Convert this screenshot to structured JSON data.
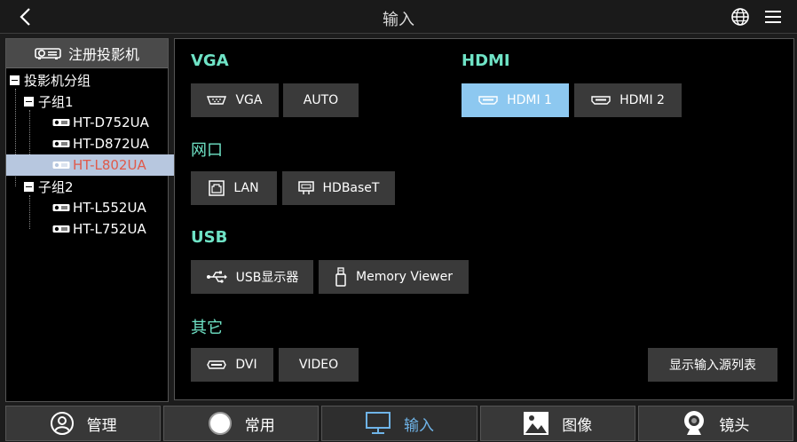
{
  "header": {
    "title": "输入"
  },
  "sidebar": {
    "register_label": "注册投影机",
    "root": "投影机分组",
    "groups": [
      {
        "label": "子组1",
        "devices": [
          "HT-D752UA",
          "HT-D872UA",
          "HT-L802UA"
        ]
      },
      {
        "label": "子组2",
        "devices": [
          "HT-L552UA",
          "HT-L752UA"
        ]
      }
    ],
    "selected_device": "HT-L802UA"
  },
  "sections": {
    "vga": {
      "title": "VGA",
      "buttons": [
        "VGA",
        "AUTO"
      ]
    },
    "hdmi": {
      "title": "HDMI",
      "buttons": [
        "HDMI 1",
        "HDMI 2"
      ],
      "active": "HDMI 1"
    },
    "network": {
      "title": "网口",
      "buttons": [
        "LAN",
        "HDBaseT"
      ]
    },
    "usb": {
      "title": "USB",
      "buttons": [
        "USB显示器",
        "Memory Viewer"
      ]
    },
    "other": {
      "title": "其它",
      "buttons": [
        "DVI",
        "VIDEO"
      ]
    }
  },
  "show_list_label": "显示输入源列表",
  "tabs": [
    {
      "label": "管理",
      "icon": "user-icon"
    },
    {
      "label": "常用",
      "icon": "circle-icon"
    },
    {
      "label": "输入",
      "icon": "monitor-icon"
    },
    {
      "label": "图像",
      "icon": "image-icon"
    },
    {
      "label": "镜头",
      "icon": "webcam-icon"
    }
  ],
  "active_tab": "输入",
  "colors": {
    "accent_text": "#6fe3c6",
    "active_button": "#8dc8f0",
    "selected_row": "#b7c7df",
    "selected_text": "#e05a4a",
    "active_tab_text": "#6fb4e8"
  }
}
